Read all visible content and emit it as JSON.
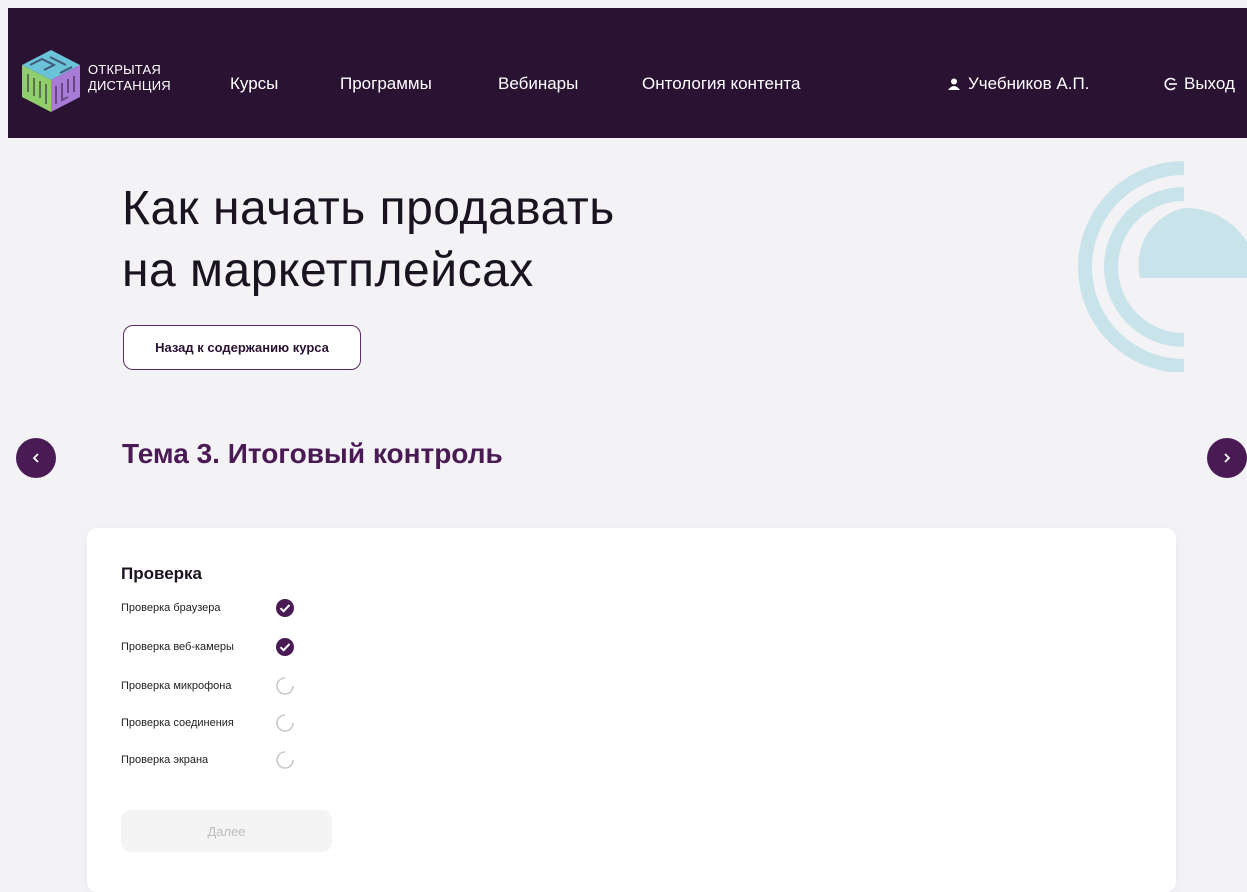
{
  "header": {
    "logo_line1": "ОТКРЫТАЯ",
    "logo_line2": "ДИСТАНЦИЯ",
    "nav": [
      {
        "label": "Курсы"
      },
      {
        "label": "Программы"
      },
      {
        "label": "Вебинары"
      },
      {
        "label": "Онтология контента"
      }
    ],
    "user_name": "Учебников А.П.",
    "logout_label": "Выход"
  },
  "page": {
    "title_line1": "Как начать продавать",
    "title_line2": "на маркетплейсах",
    "back_label": "Назад к содержанию курса",
    "topic_title": "Тема 3. Итоговый контроль"
  },
  "check": {
    "title": "Проверка",
    "items": [
      {
        "label": "Проверка браузера",
        "status": "done"
      },
      {
        "label": "Проверка веб-камеры",
        "status": "done"
      },
      {
        "label": "Проверка микрофона",
        "status": "loading"
      },
      {
        "label": "Проверка соединения",
        "status": "loading"
      },
      {
        "label": "Проверка экрана",
        "status": "loading"
      }
    ],
    "next_label": "Далее"
  },
  "colors": {
    "header_bg": "#2a1233",
    "accent": "#4a1a55",
    "deco": "#c9e3ea"
  },
  "icons": {
    "user": "user-icon",
    "logout": "logout-icon",
    "prev": "chevron-left-icon",
    "next": "chevron-right-icon",
    "done": "check-circle-icon",
    "loading": "spinner-icon"
  }
}
